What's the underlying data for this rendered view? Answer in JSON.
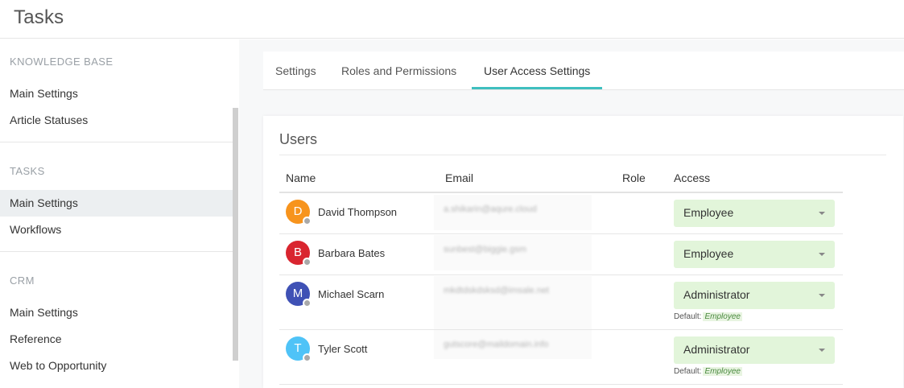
{
  "app": {
    "title": "Tasks"
  },
  "sidebar": {
    "sections": [
      {
        "title": "KNOWLEDGE BASE",
        "items": [
          "Main Settings",
          "Article Statuses"
        ]
      },
      {
        "title": "TASKS",
        "items": [
          "Main Settings",
          "Workflows"
        ]
      },
      {
        "title": "CRM",
        "items": [
          "Main Settings",
          "Reference",
          "Web to Opportunity"
        ]
      }
    ],
    "active": "TASKS / Main Settings"
  },
  "tabs": [
    {
      "label": "Settings"
    },
    {
      "label": "Roles and Permissions"
    },
    {
      "label": "User Access Settings",
      "active": true
    }
  ],
  "users_card": {
    "title": "Users",
    "columns": [
      "Name",
      "Email",
      "Role",
      "Access"
    ],
    "rows": [
      {
        "initial": "D",
        "name": "David Thompson",
        "email": "a.shikarin@aqure.cloud",
        "role": "",
        "access": "Employee",
        "avatar_color": "#f7941d"
      },
      {
        "initial": "B",
        "name": "Barbara Bates",
        "email": "sunbest@biggie.gsm",
        "role": "",
        "access": "Employee",
        "avatar_color": "#d9252f"
      },
      {
        "initial": "M",
        "name": "Michael Scarn",
        "email": "mkdtdskdsksd@imsale.net",
        "role": "",
        "access": "Administrator",
        "default_label": "Default:",
        "default_value": "Employee",
        "avatar_color": "#3f51b5"
      },
      {
        "initial": "T",
        "name": "Tyler Scott",
        "email": "gutscore@maildomain.info",
        "role": "",
        "access": "Administrator",
        "default_label": "Default:",
        "default_value": "Employee",
        "avatar_color": "#4fc3f7"
      }
    ]
  },
  "colors": {
    "accent_tab": "#3fbfbf",
    "access_bg": "#e2f5da"
  }
}
